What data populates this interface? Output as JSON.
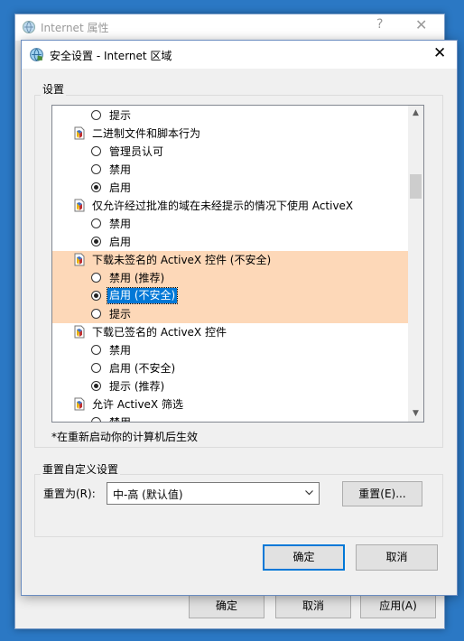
{
  "parent_window": {
    "title": "Internet 属性",
    "help": "?",
    "close": "✕",
    "buttons": {
      "ok": "确定",
      "cancel": "取消",
      "apply": "应用(A)"
    }
  },
  "dialog": {
    "title": "安全设置 - Internet 区域",
    "close": "✕",
    "settings_group_label": "设置",
    "settings_list": [
      {
        "kind": "option",
        "label": "提示",
        "checked": false
      },
      {
        "kind": "category",
        "label": "二进制文件和脚本行为"
      },
      {
        "kind": "option",
        "label": "管理员认可",
        "checked": false
      },
      {
        "kind": "option",
        "label": "禁用",
        "checked": false
      },
      {
        "kind": "option",
        "label": "启用",
        "checked": true
      },
      {
        "kind": "category",
        "label": "仅允许经过批准的域在未经提示的情况下使用 ActiveX"
      },
      {
        "kind": "option",
        "label": "禁用",
        "checked": false
      },
      {
        "kind": "option",
        "label": "启用",
        "checked": true
      },
      {
        "kind": "category",
        "label": "下载未签名的 ActiveX 控件 (不安全)",
        "highlight": true
      },
      {
        "kind": "option",
        "label": "禁用 (推荐)",
        "checked": false,
        "highlight": true
      },
      {
        "kind": "option",
        "label": "启用 (不安全)",
        "checked": true,
        "highlight": true,
        "selected": true
      },
      {
        "kind": "option",
        "label": "提示",
        "checked": false,
        "highlight": true
      },
      {
        "kind": "category",
        "label": "下载已签名的 ActiveX 控件"
      },
      {
        "kind": "option",
        "label": "禁用",
        "checked": false
      },
      {
        "kind": "option",
        "label": "启用 (不安全)",
        "checked": false
      },
      {
        "kind": "option",
        "label": "提示 (推荐)",
        "checked": true
      },
      {
        "kind": "category",
        "label": "允许 ActiveX 筛选"
      },
      {
        "kind": "option",
        "label": "禁用",
        "checked": false
      }
    ],
    "restart_note": "*在重新启动你的计算机后生效",
    "reset_group_label": "重置自定义设置",
    "reset_to_label": "重置为(R):",
    "reset_level_value": "中-高 (默认值)",
    "reset_button": "重置(E)...",
    "ok_button": "确定",
    "cancel_button": "取消"
  },
  "colors": {
    "highlight_row": "#fdd8b8",
    "selection": "#0078d7",
    "accent": "#0078d7"
  }
}
